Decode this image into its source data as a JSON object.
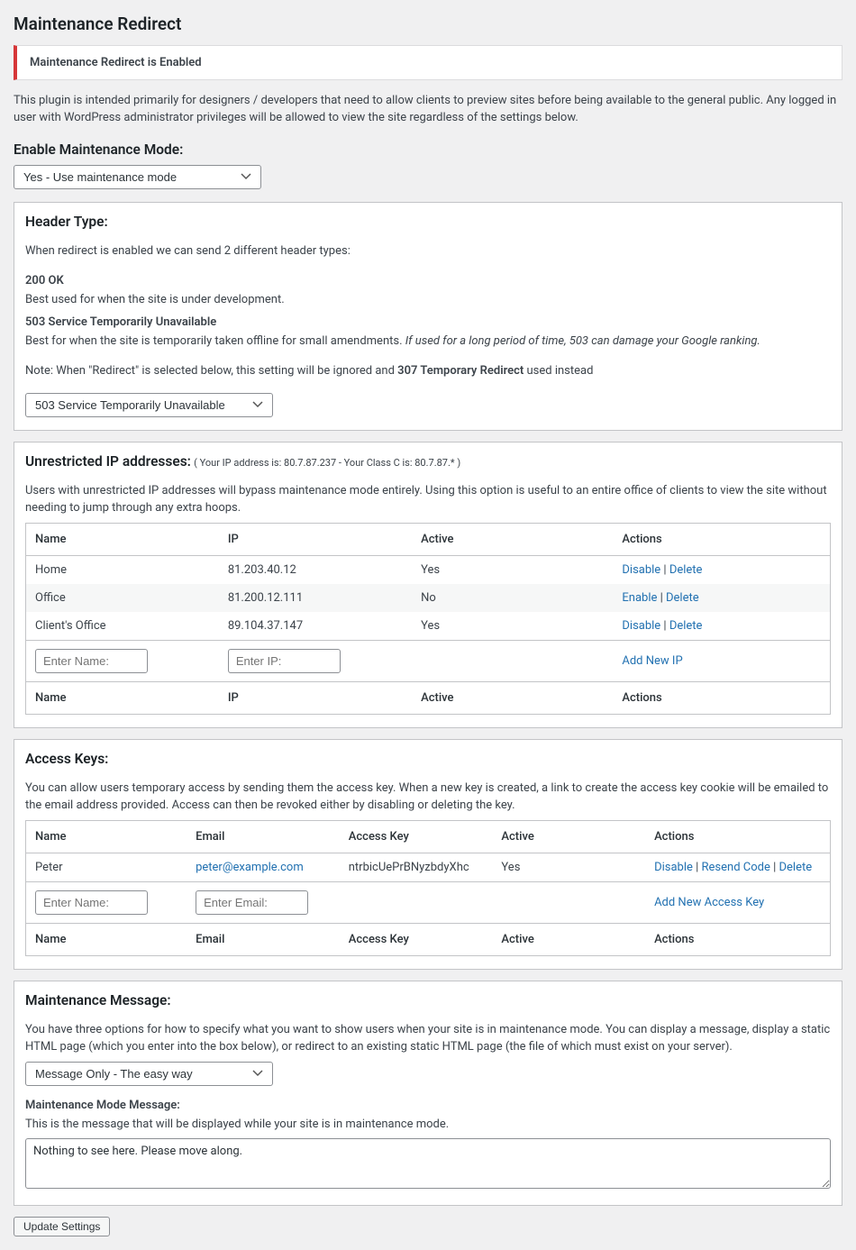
{
  "page_title": "Maintenance Redirect",
  "notice": "Maintenance Redirect is Enabled",
  "plugin_desc": "This plugin is intended primarily for designers / developers that need to allow clients to preview sites before being available to the general public. Any logged in user with WordPress administrator privileges will be allowed to view the site regardless of the settings below.",
  "enable_mode": {
    "heading": "Enable Maintenance Mode:",
    "selected": "Yes - Use maintenance mode"
  },
  "header_type": {
    "heading": "Header Type:",
    "intro": "When redirect is enabled we can send 2 different header types:",
    "opt1_title": "200 OK",
    "opt1_desc": "Best used for when the site is under development.",
    "opt2_title": "503 Service Temporarily Unavailable",
    "opt2_desc_pre": "Best for when the site is temporarily taken offline for small amendments. ",
    "opt2_desc_em": "If used for a long period of time, 503 can damage your Google ranking.",
    "note_pre": "Note: When \"Redirect\" is selected below, this setting will be ignored and ",
    "note_bold": "307 Temporary Redirect",
    "note_post": " used instead",
    "selected": "503 Service Temporarily Unavailable"
  },
  "ip_section": {
    "heading": "Unrestricted IP addresses:",
    "ip_info": "( Your IP address is: 80.7.87.237 - Your Class C is: 80.7.87.* )",
    "desc": "Users with unrestricted IP addresses will bypass maintenance mode entirely. Using this option is useful to an entire office of clients to view the site without needing to jump through any extra hoops.",
    "cols": {
      "name": "Name",
      "ip": "IP",
      "active": "Active",
      "actions": "Actions"
    },
    "rows": [
      {
        "name": "Home",
        "ip": "81.203.40.12",
        "active": "Yes",
        "toggle": "Disable",
        "delete": "Delete"
      },
      {
        "name": "Office",
        "ip": "81.200.12.111",
        "active": "No",
        "toggle": "Enable",
        "delete": "Delete"
      },
      {
        "name": "Client's Office",
        "ip": "89.104.37.147",
        "active": "Yes",
        "toggle": "Disable",
        "delete": "Delete"
      }
    ],
    "add": {
      "name_ph": "Enter Name:",
      "ip_ph": "Enter IP:",
      "link": "Add New IP"
    }
  },
  "keys_section": {
    "heading": "Access Keys:",
    "desc": "You can allow users temporary access by sending them the access key. When a new key is created, a link to create the access key cookie will be emailed to the email address provided. Access can then be revoked either by disabling or deleting the key.",
    "cols": {
      "name": "Name",
      "email": "Email",
      "key": "Access Key",
      "active": "Active",
      "actions": "Actions"
    },
    "rows": [
      {
        "name": "Peter",
        "email": "peter@example.com",
        "key": "ntrbicUePrBNyzbdyXhc",
        "active": "Yes",
        "toggle": "Disable",
        "resend": "Resend Code",
        "delete": "Delete"
      }
    ],
    "add": {
      "name_ph": "Enter Name:",
      "email_ph": "Enter Email:",
      "link": "Add New Access Key"
    }
  },
  "message_section": {
    "heading": "Maintenance Message:",
    "desc": "You have three options for how to specify what you want to show users when your site is in maintenance mode. You can display a message, display a static HTML page (which you enter into the box below), or redirect to an existing static HTML page (the file of which must exist on your server).",
    "selected": "Message Only - The easy way",
    "sub_heading": "Maintenance Mode Message:",
    "sub_desc": "This is the message that will be displayed while your site is in maintenance mode.",
    "textarea": "Nothing to see here. Please move along."
  },
  "submit": "Update Settings",
  "sep": " | "
}
